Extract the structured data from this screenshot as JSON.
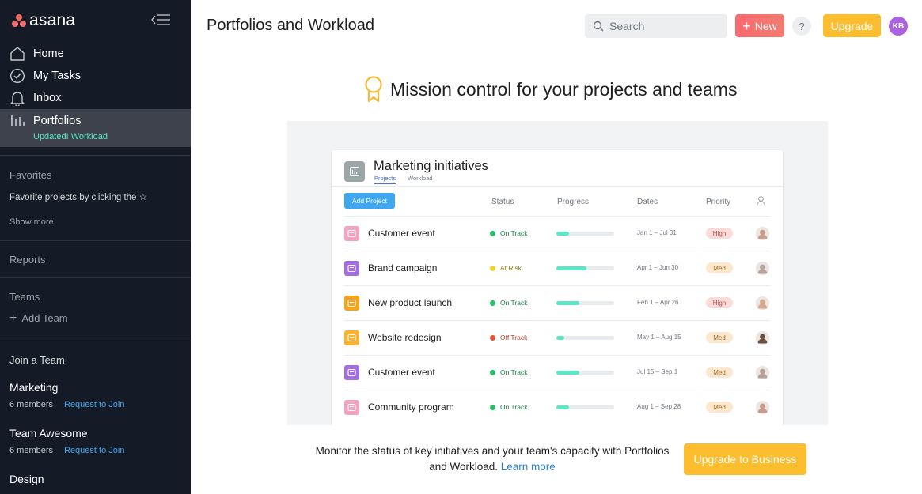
{
  "brand": {
    "name": "asana"
  },
  "sidebar": {
    "nav": [
      {
        "label": "Home",
        "icon": "home-icon"
      },
      {
        "label": "My Tasks",
        "icon": "check-circle-icon"
      },
      {
        "label": "Inbox",
        "icon": "bell-icon"
      },
      {
        "label": "Portfolios",
        "icon": "bar-chart-icon",
        "sub": "Updated! Workload",
        "active": true
      }
    ],
    "favorites": {
      "heading": "Favorites",
      "hint": "Favorite projects by clicking the ☆",
      "show_more": "Show more"
    },
    "reports": {
      "heading": "Reports"
    },
    "teams": {
      "heading": "Teams",
      "add_label": "Add Team"
    },
    "join": {
      "heading": "Join a Team",
      "teams": [
        {
          "name": "Marketing",
          "members": "6 members",
          "action": "Request to Join"
        },
        {
          "name": "Team Awesome",
          "members": "6 members",
          "action": "Request to Join"
        },
        {
          "name": "Design",
          "members": "",
          "action": ""
        }
      ]
    }
  },
  "topbar": {
    "title": "Portfolios and Workload",
    "search_placeholder": "Search",
    "new_label": "New",
    "help_label": "?",
    "upgrade_label": "Upgrade",
    "avatar_initials": "KB"
  },
  "hero": {
    "title": "Mission control for your projects and teams"
  },
  "preview": {
    "title": "Marketing initiatives",
    "tabs": [
      "Projects",
      "Workload"
    ],
    "add_project": "Add Project",
    "columns": [
      "Status",
      "Progress",
      "Dates",
      "Priority"
    ],
    "rows": [
      {
        "name": "Customer event",
        "status": "On Track",
        "status_color": "#27c068",
        "status_text_color": "#1a7a44",
        "progress": 0.22,
        "dates": "Jan 1 – Jul 31",
        "priority": "High",
        "icon_color": "#f4a3c1",
        "avatar_color": "#c9a08a"
      },
      {
        "name": "Brand campaign",
        "status": "At Risk",
        "status_color": "#f1d22c",
        "status_text_color": "#8a7a1a",
        "progress": 0.52,
        "dates": "Apr 1 – Jun 30",
        "priority": "Med",
        "icon_color": "#a46ee3",
        "avatar_color": "#b7a59d"
      },
      {
        "name": "New product launch",
        "status": "On Track",
        "status_color": "#27c068",
        "status_text_color": "#1a7a44",
        "progress": 0.4,
        "dates": "Feb 1 – Apr 26",
        "priority": "High",
        "icon_color": "#f6a41c",
        "avatar_color": "#d9a58b"
      },
      {
        "name": "Website redesign",
        "status": "Off Track",
        "status_color": "#e8532f",
        "status_text_color": "#b3402a",
        "progress": 0.14,
        "dates": "May 1 – Aug 15",
        "priority": "Med",
        "icon_color": "#f8b333",
        "avatar_color": "#6f4f3f"
      },
      {
        "name": "Customer event",
        "status": "On Track",
        "status_color": "#27c068",
        "status_text_color": "#1a7a44",
        "progress": 0.4,
        "dates": "Jul 15 – Sep 1",
        "priority": "Med",
        "icon_color": "#a46ee3",
        "avatar_color": "#b9a197"
      },
      {
        "name": "Community program",
        "status": "On Track",
        "status_color": "#27c068",
        "status_text_color": "#1a7a44",
        "progress": 0.22,
        "dates": "Aug 1 – Sep 28",
        "priority": "Med",
        "icon_color": "#f4a3c1",
        "avatar_color": "#c89a8a"
      }
    ]
  },
  "footer": {
    "text": "Monitor the status of key initiatives and your team's capacity with Portfolios and Workload.",
    "link": "Learn more",
    "cta": "Upgrade to Business"
  },
  "colors": {
    "sidebar_bg": "#151b26",
    "accent_new": "#f96a71",
    "upgrade": "#fcbd2f",
    "link": "#3fa7ef",
    "progress": "#5ce6c8"
  }
}
